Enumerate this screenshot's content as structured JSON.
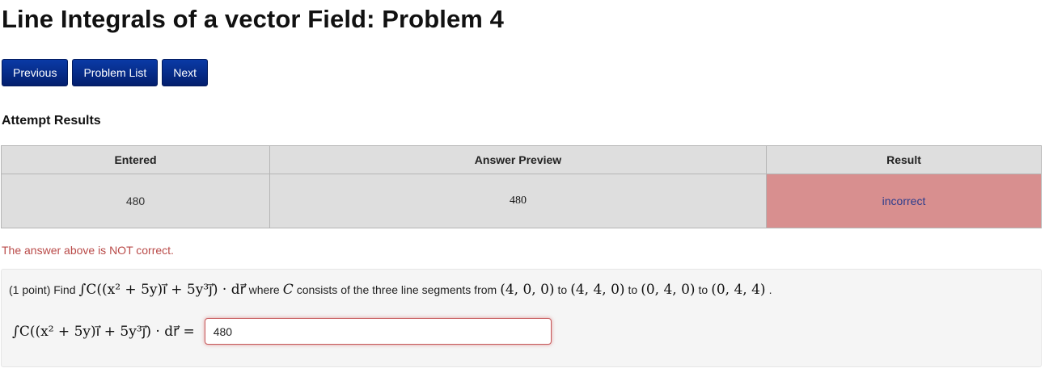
{
  "page": {
    "title": "Line Integrals of a vector Field: Problem 4"
  },
  "nav": {
    "previous_label": "Previous",
    "problem_list_label": "Problem List",
    "next_label": "Next"
  },
  "attempt": {
    "heading": "Attempt Results",
    "columns": [
      "Entered",
      "Answer Preview",
      "Result"
    ],
    "rows": [
      {
        "entered": "480",
        "preview": "480",
        "result": "incorrect"
      }
    ],
    "result_color": "#d88f8f",
    "feedback": "The answer above is NOT correct.",
    "feedback_color": "#b94a48"
  },
  "problem": {
    "points": "(1 point) Find",
    "integral_expr": "∫C((x² + 5y)i⃗ + 5y³j⃗) · dr⃗",
    "where_text": "where",
    "curve_var": "C",
    "consists_text": "consists of the three line segments from",
    "p1": "(4, 0, 0)",
    "to1": "to",
    "p2": "(4, 4, 0)",
    "to2": "to",
    "p3": "(0, 4, 0)",
    "to3": "to",
    "p4": "(0, 4, 4)",
    "end": ".",
    "answer_lhs": "∫C((x² + 5y)i⃗ + 5y³j⃗) · dr⃗ =",
    "answer_value": "480"
  },
  "colors": {
    "nav_button": "#062b8a",
    "box_background": "#f5f5f5",
    "table_background": "#dedede"
  }
}
